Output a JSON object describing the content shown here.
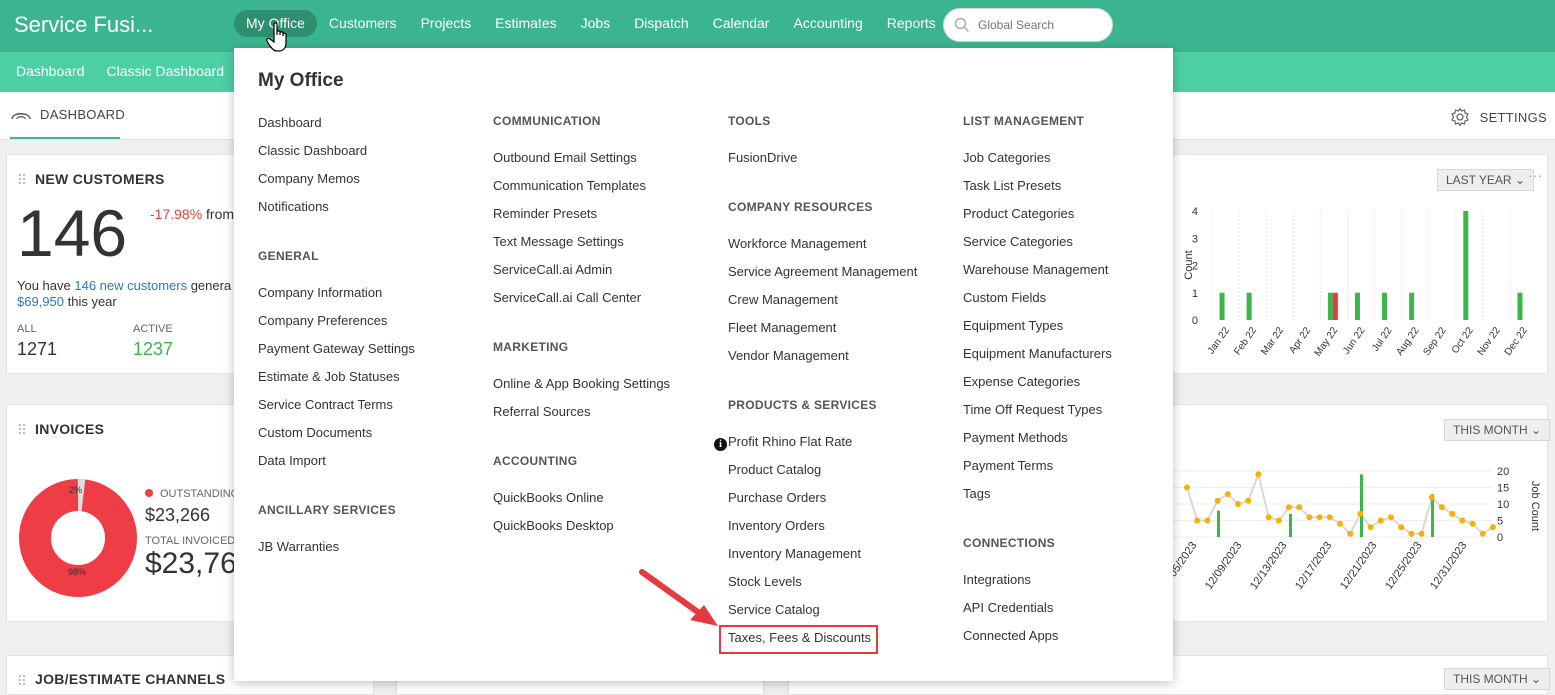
{
  "app": {
    "title": "Service Fusi..."
  },
  "nav": {
    "items": [
      "My Office",
      "Customers",
      "Projects",
      "Estimates",
      "Jobs",
      "Dispatch",
      "Calendar",
      "Accounting",
      "Reports"
    ],
    "search_placeholder": "Global Search"
  },
  "subnav": {
    "items": [
      "Dashboard",
      "Classic Dashboard"
    ]
  },
  "dashbar": {
    "tab": "DASHBOARD",
    "settings": "SETTINGS"
  },
  "new_customers": {
    "title": "NEW CUSTOMERS",
    "count": "146",
    "change": "-17.98%",
    "change_suffix": "from",
    "line1_prefix": "You have ",
    "line1_link": "146 new customers",
    "line1_suffix": " genera",
    "line2_amount": "$69,950",
    "line2_suffix": " this year",
    "all_label": "ALL",
    "all_value": "1271",
    "active_label": "ACTIVE",
    "active_value": "1237",
    "period": "LAST YEAR"
  },
  "invoices": {
    "title": "INVOICES",
    "outstanding_label": "OUTSTANDING",
    "outstanding_value": "$23,266",
    "total_label": "TOTAL INVOICED",
    "total_value": "$23,76",
    "pie_small_label": "2%",
    "pie_big_label": "98%",
    "period": "THIS MONTH"
  },
  "bottom": {
    "channels_title": "JOB/ESTIMATE CHANNELS",
    "period": "THIS MONTH"
  },
  "mega": {
    "title": "My Office",
    "col1": {
      "items_a": [
        "Dashboard",
        "Classic Dashboard",
        "Company Memos",
        "Notifications"
      ],
      "general": "GENERAL",
      "items_b": [
        "Company Information",
        "Company Preferences",
        "Payment Gateway Settings",
        "Estimate & Job Statuses",
        "Service Contract Terms",
        "Custom Documents",
        "Data Import"
      ],
      "ancillary": "ANCILLARY SERVICES",
      "items_c": [
        "JB Warranties"
      ]
    },
    "col2": {
      "communication": "COMMUNICATION",
      "items_a": [
        "Outbound Email Settings",
        "Communication Templates",
        "Reminder Presets",
        "Text Message Settings",
        "ServiceCall.ai Admin",
        "ServiceCall.ai Call Center"
      ],
      "marketing": "MARKETING",
      "items_b": [
        "Online & App Booking Settings",
        "Referral Sources"
      ],
      "accounting": "ACCOUNTING",
      "items_c": [
        "QuickBooks Online",
        "QuickBooks Desktop"
      ]
    },
    "col3": {
      "tools": "TOOLS",
      "items_a": [
        "FusionDrive"
      ],
      "resources": "COMPANY RESOURCES",
      "items_b": [
        "Workforce Management",
        "Service Agreement Management",
        "Crew Management",
        "Fleet Management",
        "Vendor Management"
      ],
      "products": "PRODUCTS & SERVICES",
      "items_c": [
        "Profit Rhino Flat Rate",
        "Product Catalog",
        "Purchase Orders",
        "Inventory Orders",
        "Inventory Management",
        "Stock Levels",
        "Service Catalog",
        "Taxes, Fees & Discounts"
      ]
    },
    "col4": {
      "list": "LIST MANAGEMENT",
      "items_a": [
        "Job Categories",
        "Task List Presets",
        "Product Categories",
        "Service Categories",
        "Warehouse Management",
        "Custom Fields",
        "Equipment Types",
        "Equipment Manufacturers",
        "Expense Categories",
        "Time Off Request Types",
        "Payment Methods",
        "Payment Terms",
        "Tags"
      ],
      "connections": "CONNECTIONS",
      "items_b": [
        "Integrations",
        "API Credentials",
        "Connected Apps"
      ]
    }
  },
  "chart_data": [
    {
      "type": "bar",
      "ylabel": "Count",
      "categories": [
        "Jan 22",
        "Feb 22",
        "Mar 22",
        "Apr 22",
        "May 22",
        "Jun 22",
        "Jul 22",
        "Aug 22",
        "Sep 22",
        "Oct 22",
        "Nov 22",
        "Dec 22"
      ],
      "series": [
        {
          "values": [
            1,
            1,
            0,
            0,
            1,
            1,
            1,
            1,
            0,
            4,
            0,
            1
          ],
          "color": "#3cb54a"
        },
        {
          "values": [
            0,
            0,
            0,
            0,
            1,
            0,
            0,
            0,
            0,
            0,
            0,
            0
          ],
          "color": "#e53a40"
        }
      ],
      "yticks": [
        "4",
        "3",
        "2",
        "1",
        "0"
      ],
      "ylim": [
        0,
        4
      ]
    },
    {
      "type": "line",
      "y2label": "Job Count",
      "xticks": [
        "12/05/2023",
        "12/09/2023",
        "12/13/2023",
        "12/17/2023",
        "12/21/2023",
        "12/25/2023",
        "12/31/2023"
      ],
      "y2ticks": [
        "20",
        "15",
        "10",
        "5",
        "0"
      ],
      "ylim": [
        0,
        20
      ]
    }
  ]
}
